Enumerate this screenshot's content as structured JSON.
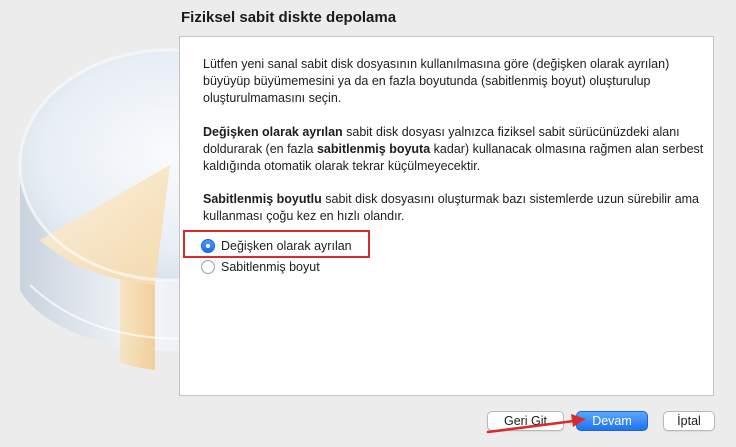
{
  "page": {
    "title": "Fiziksel sabit diskte depolama"
  },
  "description": {
    "intro": "Lütfen yeni sanal sabit disk dosyasının kullanılmasına göre (değişken olarak ayrılan) büyüyüp büyümemesini ya da en fazla boyutunda (sabitlenmiş boyut) oluşturulup oluşturulmamasını seçin.",
    "dynamic_bold": "Değişken olarak ayrılan",
    "dynamic_text_1": " sabit disk dosyası yalnızca fiziksel sabit sürücünüzdeki alanı doldurarak (en fazla ",
    "dynamic_bold_2": "sabitlenmiş boyuta",
    "dynamic_text_2": " kadar) kullanacak olmasına rağmen alan serbest kaldığında otomatik olarak tekrar küçülmeyecektir.",
    "fixed_bold": "Sabitlenmiş boyutlu",
    "fixed_text": " sabit disk dosyasını oluşturmak bazı sistemlerde uzun sürebilir ama kullanması çoğu kez en hızlı olandır."
  },
  "options": [
    {
      "label": "Değişken olarak ayrılan",
      "selected": true
    },
    {
      "label": "Sabitlenmiş boyut",
      "selected": false
    }
  ],
  "buttons": {
    "back": "Geri Git",
    "next": "Devam",
    "cancel": "İptal"
  },
  "annotation": {
    "highlight_color": "#d92b2b"
  }
}
